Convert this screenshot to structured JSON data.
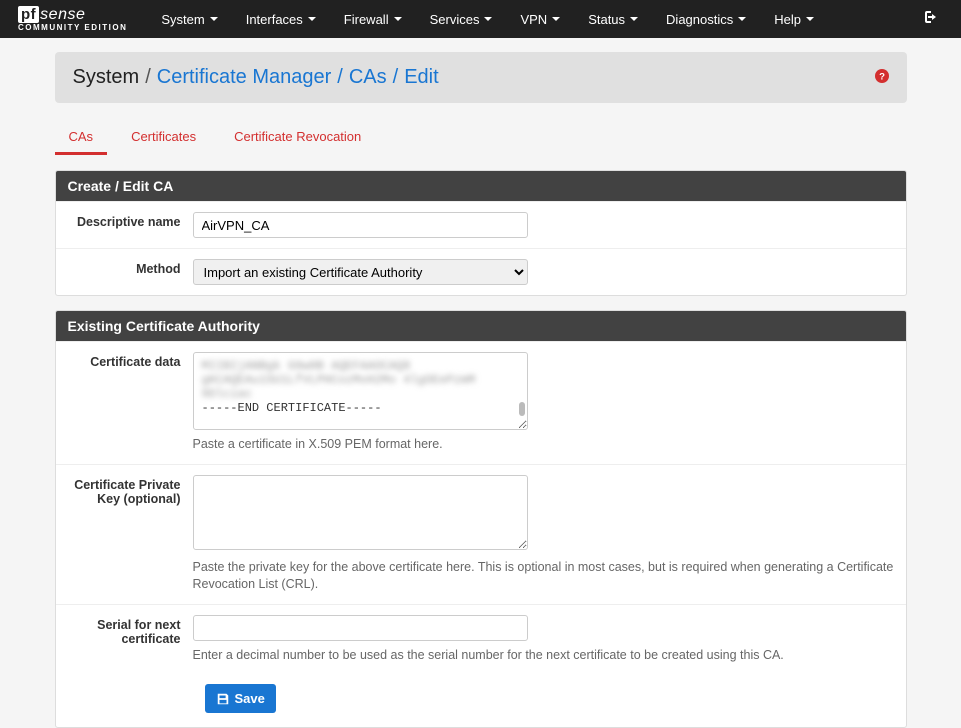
{
  "logo": {
    "pf": "pf",
    "sense": "sense",
    "sub": "COMMUNITY EDITION"
  },
  "nav": {
    "items": [
      {
        "label": "System"
      },
      {
        "label": "Interfaces"
      },
      {
        "label": "Firewall"
      },
      {
        "label": "Services"
      },
      {
        "label": "VPN"
      },
      {
        "label": "Status"
      },
      {
        "label": "Diagnostics"
      },
      {
        "label": "Help"
      }
    ]
  },
  "breadcrumb": {
    "items": [
      "System",
      "Certificate Manager",
      "CAs",
      "Edit"
    ]
  },
  "tabs": [
    {
      "label": "CAs",
      "active": true
    },
    {
      "label": "Certificates",
      "active": false
    },
    {
      "label": "Certificate Revocation",
      "active": false
    }
  ],
  "panel1": {
    "title": "Create / Edit CA",
    "name_label": "Descriptive name",
    "name_value": "AirVPN_CA",
    "method_label": "Method",
    "method_value": "Import an existing Certificate Authority"
  },
  "panel2": {
    "title": "Existing Certificate Authority",
    "cert_label": "Certificate data",
    "cert_blur": "MIIBIjANBgk G9w0B\nAQEFAAOCAQ8 gKCAQEAu1SU1LfVLPHCozMxH2Mo 4lgOEePzmM\n9Dlciac",
    "cert_end": "-----END CERTIFICATE-----",
    "cert_help": "Paste a certificate in X.509 PEM format here.",
    "key_label": "Certificate Private Key (optional)",
    "key_value": "",
    "key_help": "Paste the private key for the above certificate here. This is optional in most cases, but is required when generating a Certificate Revocation List (CRL).",
    "serial_label": "Serial for next certificate",
    "serial_value": "",
    "serial_help": "Enter a decimal number to be used as the serial number for the next certificate to be created using this CA.",
    "save_label": "Save"
  }
}
